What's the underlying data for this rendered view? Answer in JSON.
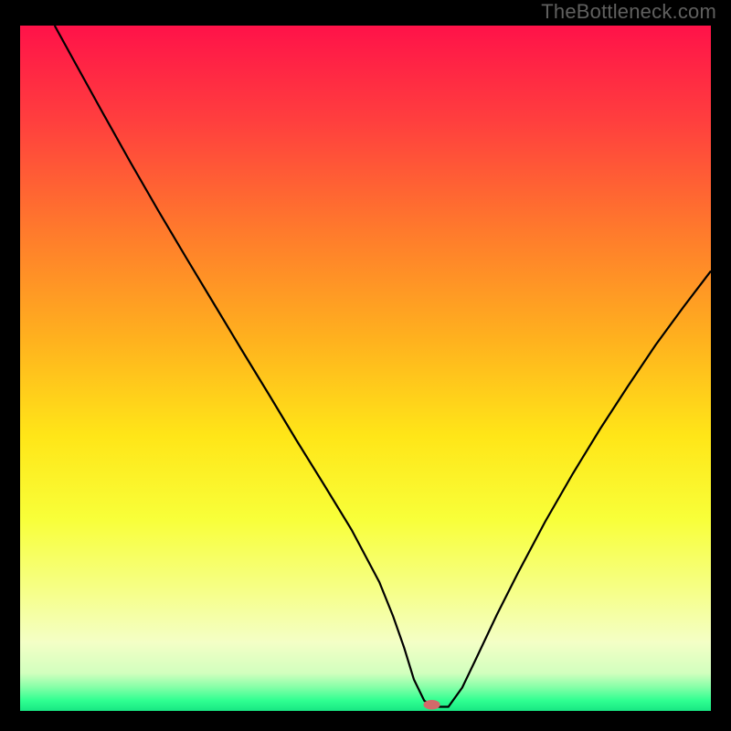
{
  "watermark": "TheBottleneck.com",
  "chart_data": {
    "type": "line",
    "title": "",
    "xlabel": "",
    "ylabel": "",
    "xlim": [
      0,
      100
    ],
    "ylim": [
      0,
      100
    ],
    "grid": false,
    "background_gradient": {
      "stops": [
        {
          "offset": 0.0,
          "color": "#ff1249"
        },
        {
          "offset": 0.14,
          "color": "#ff3f3e"
        },
        {
          "offset": 0.3,
          "color": "#ff7a2c"
        },
        {
          "offset": 0.46,
          "color": "#ffb21e"
        },
        {
          "offset": 0.6,
          "color": "#ffe618"
        },
        {
          "offset": 0.72,
          "color": "#f8ff39"
        },
        {
          "offset": 0.82,
          "color": "#f6ff84"
        },
        {
          "offset": 0.9,
          "color": "#f4ffc6"
        },
        {
          "offset": 0.945,
          "color": "#d2ffbe"
        },
        {
          "offset": 0.965,
          "color": "#87ffa8"
        },
        {
          "offset": 0.985,
          "color": "#2fff91"
        },
        {
          "offset": 1.0,
          "color": "#18e783"
        }
      ]
    },
    "series": [
      {
        "name": "bottleneck-curve",
        "color": "#000000",
        "x": [
          5.0,
          8.0,
          12.0,
          16.0,
          20.0,
          24.0,
          28.0,
          32.0,
          36.0,
          40.0,
          44.0,
          48.0,
          52.0,
          54.0,
          55.6,
          57.0,
          58.5,
          59.8,
          60.6,
          62.0,
          64.0,
          66.0,
          69.0,
          72.0,
          76.0,
          80.0,
          84.0,
          88.0,
          92.0,
          96.0,
          100.0
        ],
        "y": [
          100.0,
          94.5,
          87.2,
          80.0,
          73.0,
          66.2,
          59.5,
          52.8,
          46.2,
          39.5,
          33.0,
          26.4,
          18.8,
          13.8,
          9.2,
          4.6,
          1.5,
          0.6,
          0.6,
          0.6,
          3.4,
          7.6,
          14.0,
          20.0,
          27.6,
          34.6,
          41.2,
          47.4,
          53.4,
          58.9,
          64.2
        ]
      }
    ],
    "marker": {
      "name": "optimal-point",
      "color": "#d36a6a",
      "x": 59.6,
      "y": 0.9,
      "rx": 1.2,
      "ry": 0.7
    }
  }
}
